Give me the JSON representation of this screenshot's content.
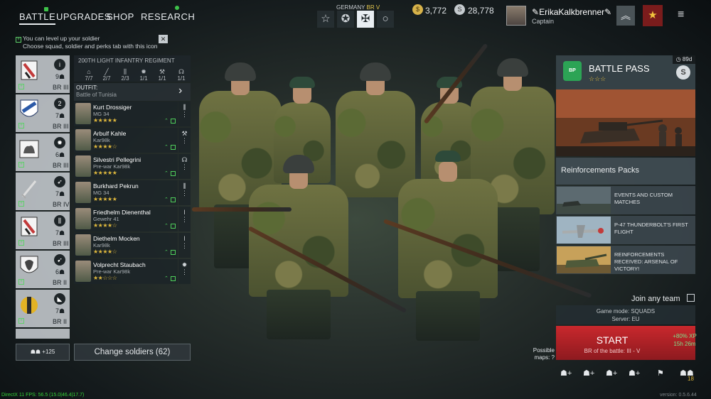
{
  "nav": {
    "tabs": [
      "BATTLE",
      "UPGRADES",
      "SHOP",
      "RESEARCH"
    ]
  },
  "nation": {
    "name": "GERMANY",
    "br": "BR V"
  },
  "game_modes": [
    "☆",
    "✪",
    "✠",
    "○"
  ],
  "currency": {
    "silver": "3,772",
    "gold": "28,778"
  },
  "profile": {
    "username": "ErikaKalkbrenner",
    "rank": "Captain"
  },
  "tip": {
    "line1": "You can level up your soldier",
    "line2": "Choose squad, soldier and perks tab with this icon"
  },
  "squads": [
    {
      "count": "9",
      "br": "BR III",
      "class": "i"
    },
    {
      "count": "7",
      "br": "BR III",
      "class": "2"
    },
    {
      "count": "6",
      "br": "BR III",
      "class": "✹"
    },
    {
      "count": "7",
      "br": "BR IV",
      "class": "➶"
    },
    {
      "count": "7",
      "br": "BR III",
      "class": "⫼"
    },
    {
      "count": "6",
      "br": "BR II",
      "class": "➹"
    },
    {
      "count": "7",
      "br": "BR II",
      "class": "◣"
    }
  ],
  "regiment": {
    "title": "200TH LIGHT INFANTRY REGIMENT",
    "stats": [
      "7/7",
      "2/7",
      "2/3",
      "1/1",
      "1/1",
      "1/1"
    ]
  },
  "outfit": {
    "label": "OUTFIT:",
    "value": "Battle of Tunisia"
  },
  "soldiers": [
    {
      "name": "Kurt Drossiger",
      "weapon": "MG 34",
      "stars": "★★★★★",
      "slot": "⫼"
    },
    {
      "name": "Arbulf Kahle",
      "weapon": "Kar98k",
      "stars": "★★★★☆",
      "slot": "⚒"
    },
    {
      "name": "Silvestri Pellegrini",
      "weapon": "Pre-war Kar98k",
      "stars": "★★★★★",
      "slot": "☊"
    },
    {
      "name": "Burkhard Pekrun",
      "weapon": "MG 34",
      "stars": "★★★★★",
      "slot": "⫼"
    },
    {
      "name": "Friedhelm Dienenthal",
      "weapon": "Gewehr 41",
      "stars": "★★★★☆",
      "slot": "ǀ"
    },
    {
      "name": "Diethelm Mocken",
      "weapon": "Kar98k",
      "stars": "★★★★☆",
      "slot": "ǀ"
    },
    {
      "name": "Volprecht Staubach",
      "weapon": "Pre-war Kar98k",
      "stars": "★★☆☆☆",
      "slot": "✹"
    }
  ],
  "bottom_left": {
    "squads_count": "+125",
    "change_label": "Change soldiers (62)"
  },
  "battle_pass": {
    "timer": "89d",
    "title": "BATTLE PASS",
    "stars": "☆☆☆"
  },
  "reinforcements": "Reinforcements Packs",
  "news": [
    "EVENTS AND CUSTOM MATCHES",
    "P-47 THUNDERBOLT'S FIRST FLIGHT",
    "REINFORCEMENTS RECEIVED: ARSENAL OF VICTORY!"
  ],
  "join": "Join any team",
  "mode": {
    "line1": "Game mode: SQUADS",
    "line2": "Server: EU"
  },
  "start": {
    "label": "START",
    "br": "BR of the battle: III - V",
    "xp": "+80% XP",
    "time": "15h 26m"
  },
  "maps": "Possible maps:",
  "party_count": "18",
  "debug": "DirectX 11 FPS: 56.5 (15.0|46.4|17.7)",
  "version": "version: 0.5.6.44",
  "colors": {
    "accent_green": "#3ec24a",
    "start_red": "#c9282d",
    "star_gold": "#e0b93d"
  }
}
